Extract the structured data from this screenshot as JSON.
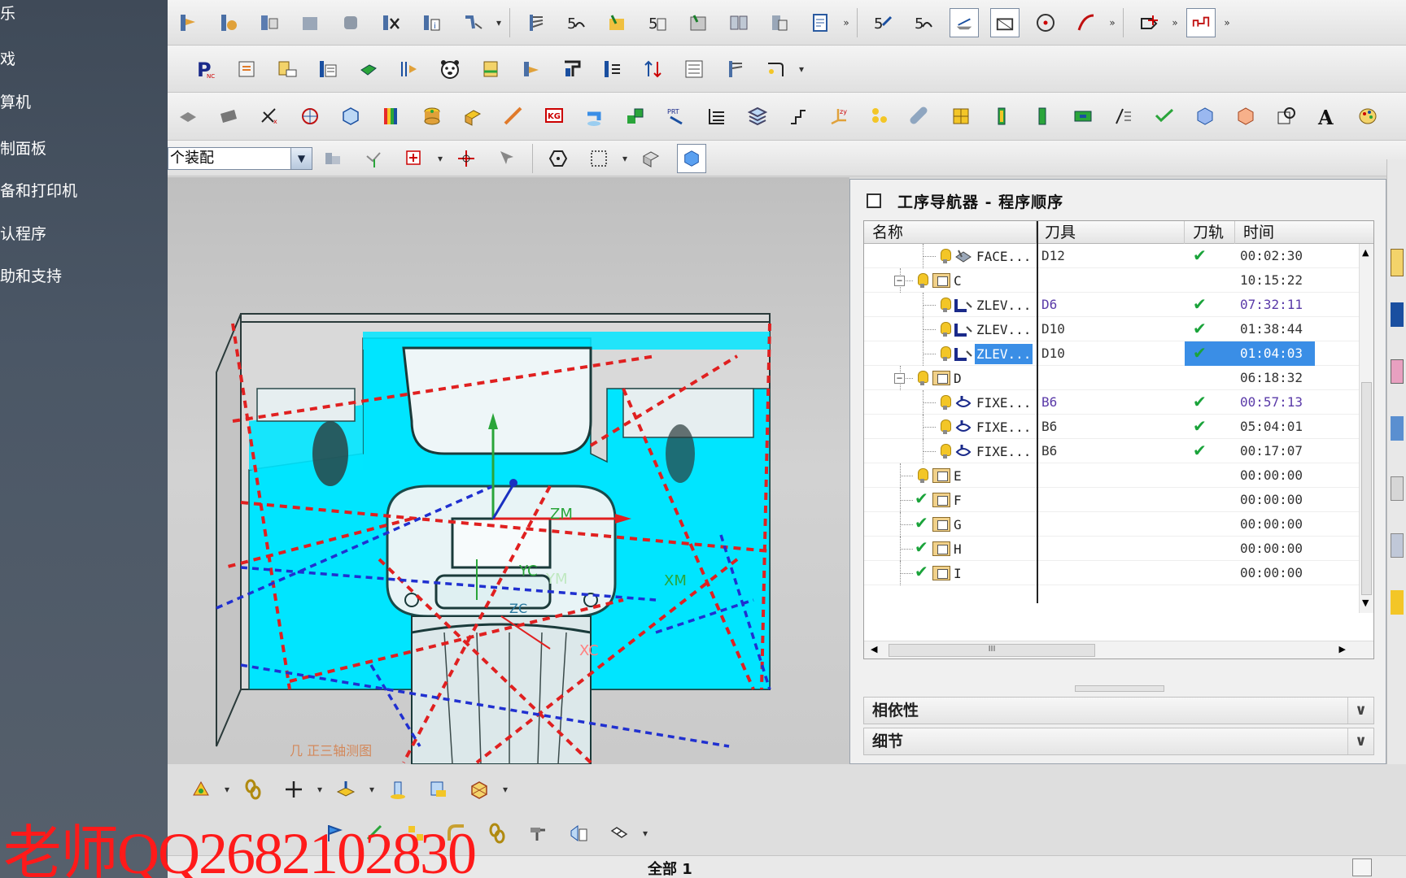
{
  "left_menu": {
    "items": [
      "乐",
      "戏",
      "算机",
      "制面板",
      "备和打印机",
      "认程序",
      "助和支持"
    ]
  },
  "toolbar": {
    "assembly_select_value": "个装配",
    "overflow_chevron": "»"
  },
  "viewport": {
    "axis_labels": {
      "ym": "YM",
      "zm": "ZM",
      "yc": "YC",
      "xm": "XM",
      "zc": "ZC",
      "xc": "XC"
    },
    "status_hint": "几 正三轴测图"
  },
  "navigator": {
    "title": "工序导航器 - 程序顺序",
    "columns": {
      "name": "名称",
      "tool": "刀具",
      "path": "刀轨",
      "time": "时间"
    },
    "rows": [
      {
        "name": "FACE...",
        "tool": "D12",
        "path_ok": true,
        "time": "00:02:30",
        "kind": "op-face",
        "status": "bulb",
        "level": 2,
        "purple": false,
        "selected": false
      },
      {
        "name": "C",
        "tool": "",
        "path_ok": false,
        "time": "10:15:22",
        "kind": "group",
        "status": "bulb",
        "level": 1,
        "expander": "⊟",
        "purple": false,
        "selected": false
      },
      {
        "name": "ZLEV...",
        "tool": "D6",
        "path_ok": true,
        "time": "07:32:11",
        "kind": "op-zlevel",
        "status": "bulb",
        "level": 2,
        "purple": true,
        "selected": false
      },
      {
        "name": "ZLEV...",
        "tool": "D10",
        "path_ok": true,
        "time": "01:38:44",
        "kind": "op-zlevel",
        "status": "bulb",
        "level": 2,
        "purple": false,
        "selected": false
      },
      {
        "name": "ZLEV...",
        "tool": "D10",
        "path_ok": true,
        "time": "01:04:03",
        "kind": "op-zlevel",
        "status": "bulb",
        "level": 2,
        "purple": false,
        "selected": true
      },
      {
        "name": "D",
        "tool": "",
        "path_ok": false,
        "time": "06:18:32",
        "kind": "group",
        "status": "bulb",
        "level": 1,
        "expander": "⊟",
        "purple": false,
        "selected": false
      },
      {
        "name": "FIXE...",
        "tool": "B6",
        "path_ok": true,
        "time": "00:57:13",
        "kind": "op-fixed",
        "status": "bulb",
        "level": 2,
        "purple": true,
        "selected": false
      },
      {
        "name": "FIXE...",
        "tool": "B6",
        "path_ok": true,
        "time": "05:04:01",
        "kind": "op-fixed",
        "status": "bulb",
        "level": 2,
        "purple": false,
        "selected": false
      },
      {
        "name": "FIXE...",
        "tool": "B6",
        "path_ok": true,
        "time": "00:17:07",
        "kind": "op-fixed",
        "status": "bulb",
        "level": 2,
        "purple": false,
        "selected": false
      },
      {
        "name": "E",
        "tool": "",
        "path_ok": false,
        "time": "00:00:00",
        "kind": "group",
        "status": "bulb",
        "level": 1,
        "purple": false,
        "selected": false
      },
      {
        "name": "F",
        "tool": "",
        "path_ok": false,
        "time": "00:00:00",
        "kind": "group",
        "status": "check",
        "level": 1,
        "purple": false,
        "selected": false
      },
      {
        "name": "G",
        "tool": "",
        "path_ok": false,
        "time": "00:00:00",
        "kind": "group",
        "status": "check",
        "level": 1,
        "purple": false,
        "selected": false
      },
      {
        "name": "H",
        "tool": "",
        "path_ok": false,
        "time": "00:00:00",
        "kind": "group",
        "status": "check",
        "level": 1,
        "purple": false,
        "selected": false
      },
      {
        "name": "I",
        "tool": "",
        "path_ok": false,
        "time": "00:00:00",
        "kind": "group",
        "status": "check",
        "level": 1,
        "purple": false,
        "selected": false
      }
    ],
    "sections": {
      "dependency": "相依性",
      "details": "细节"
    },
    "hscroll_grip": "III"
  },
  "status_bar": {
    "filter": "全部 1"
  },
  "watermark": "老师QQ2682102830",
  "colors": {
    "model_cyan": "#00e5ff",
    "selection_blue": "#3a8ee6",
    "check_green": "#1aa33a",
    "watermark_red": "#ff1a1a"
  }
}
